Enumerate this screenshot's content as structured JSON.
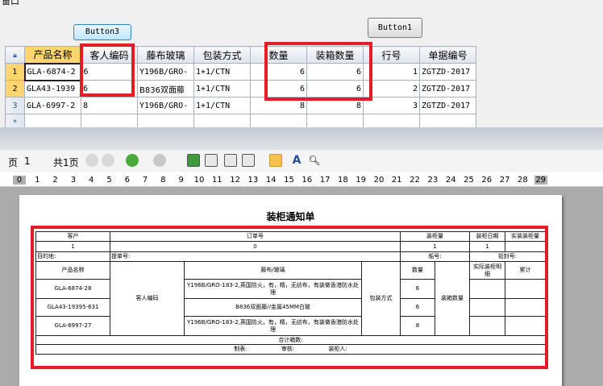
{
  "window": {
    "title": "窗口"
  },
  "buttons": {
    "button3": "Button3",
    "button1": "Button1"
  },
  "grid": {
    "columns": [
      "产品名称",
      "客人编码",
      "藤布玻璃",
      "包装方式",
      "数量",
      "装箱数量",
      "行号",
      "单据编号"
    ],
    "rows": [
      {
        "num": "1",
        "cells": [
          "GLA-6874-2",
          "6",
          "Y196B/GRO-",
          "1+1/CTN",
          "6",
          "6",
          "1",
          "ZGTZD-2017"
        ]
      },
      {
        "num": "2",
        "cells": [
          "GLA43-1939",
          "6",
          "B836双面藤",
          "1+1/CTN",
          "6",
          "6",
          "2",
          "ZGTZD-2017"
        ]
      },
      {
        "num": "3",
        "cells": [
          "GLA-6997-2",
          "8",
          "Y196B/GRO-",
          "1+1/CTN",
          "8",
          "8",
          "3",
          "ZGTZD-2017"
        ]
      }
    ],
    "new_row_marker": "*"
  },
  "toolbar": {
    "page_label": "页",
    "page_value": "1",
    "total_label": "共1页",
    "icons": [
      "first-page-icon",
      "prev-page-icon",
      "back-icon",
      "forward-icon",
      "single-page-icon",
      "two-page-icon",
      "book-icon",
      "multi-page-icon",
      "hand-icon",
      "text-icon",
      "find-icon"
    ]
  },
  "ruler": {
    "ticks": [
      "0",
      "1",
      "2",
      "3",
      "4",
      "5",
      "6",
      "7",
      "8",
      "9",
      "10",
      "11",
      "12",
      "13",
      "14",
      "15",
      "16",
      "17",
      "18",
      "19",
      "20",
      "21",
      "22",
      "23",
      "24",
      "25",
      "26",
      "27",
      "28",
      "29"
    ]
  },
  "document": {
    "title": "装柜通知单",
    "header": {
      "customer_label": "客户",
      "order_label": "订单号",
      "box_count_label": "装柜量",
      "box_date_label": "装柜日期",
      "actual_label": "实装装柜量",
      "customer_value": "1",
      "order_value": "0",
      "box_count_value": "1",
      "box_date_value": "1",
      "destination_label": "目的地:",
      "shipping_label": "提单号:",
      "ship_label": "船号:",
      "seal_label": "铅封号:"
    },
    "columns": {
      "product": "产品名称",
      "material": "藤布/玻璃",
      "customer_code": "客人编码",
      "pack": "包装方式",
      "qty": "数量",
      "box_qty": "装箱数量",
      "actual_box": "实际装柜明细",
      "total": "累计"
    },
    "items": [
      {
        "product": "GLA-6874-28",
        "material": "Y196B/GRO-183-2,英国防火，有，精，无纺布，有装做香港防水处理",
        "qty": "6"
      },
      {
        "product": "GLA43-19395-631",
        "material": "B836双面藤//金属45MM白玻",
        "qty": "6"
      },
      {
        "product": "GLA-6997-27",
        "material": "Y196B/GRO-183-2,英国防火，有，精，无纺布，有装做香港防水处理",
        "qty": "8"
      }
    ],
    "footer": {
      "total_label": "合计箱数:",
      "maker_label": "制表:",
      "auditor_label": "审核:",
      "loader_label": "装柜人:"
    }
  }
}
